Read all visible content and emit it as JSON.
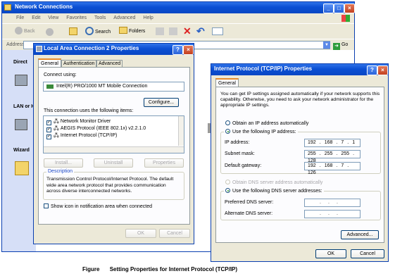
{
  "explorer": {
    "title": "Network Connections",
    "menu": [
      "File",
      "Edit",
      "View",
      "Favorites",
      "Tools",
      "Advanced",
      "Help"
    ],
    "toolbar": {
      "back": "Back",
      "search": "Search",
      "folders": "Folders"
    },
    "address_label": "Address",
    "go": "Go",
    "sidebar": [
      "Direct",
      "LAN or H",
      "Wizard"
    ]
  },
  "lan_dialog": {
    "title": "Local Area Connection 2 Properties",
    "tabs": [
      "General",
      "Authentication",
      "Advanced"
    ],
    "connect_using_label": "Connect using:",
    "adapter": "Intel(R) PRO/1000 MT Mobile Connection",
    "configure": "Configure...",
    "items_label": "This connection uses the following items:",
    "items": [
      {
        "label": "Network Monitor Driver",
        "checked": true
      },
      {
        "label": "AEGIS Protocol (IEEE 802.1x) v2.2.1.0",
        "checked": true
      },
      {
        "label": "Internet Protocol (TCP/IP)",
        "checked": true
      }
    ],
    "install": "Install...",
    "uninstall": "Uninstall",
    "properties": "Properties",
    "description_label": "Description",
    "description": "Transmission Control Protocol/Internet Protocol. The default wide area network protocol that provides communication across diverse interconnected networks.",
    "show_icon": "Show icon in notification area when connected",
    "ok": "OK",
    "cancel": "Cancel"
  },
  "tcp_dialog": {
    "title": "Internet Protocol (TCP/IP) Properties",
    "tab": "General",
    "intro": "You can get IP settings assigned automatically if your network supports this capability. Otherwise, you need to ask your network administrator for the appropriate IP settings.",
    "obtain_auto": "Obtain an IP address automatically",
    "use_following": "Use the following IP address:",
    "ip_label": "IP address:",
    "ip": [
      "192",
      "168",
      "7",
      "1"
    ],
    "mask_label": "Subnet mask:",
    "mask": [
      "255",
      "255",
      "255",
      "128"
    ],
    "gateway_label": "Default gateway:",
    "gateway": [
      "192",
      "168",
      "7",
      "126"
    ],
    "dns_auto": "Obtain DNS server address automatically",
    "dns_use": "Use the following DNS server addresses:",
    "pref_dns": "Preferred DNS server:",
    "alt_dns": "Alternate DNS server:",
    "advanced": "Advanced...",
    "ok": "OK",
    "cancel": "Cancel"
  },
  "caption": {
    "label": "Figure",
    "text": "Setting Properties for Internet Protocol (TCP/IP)"
  }
}
